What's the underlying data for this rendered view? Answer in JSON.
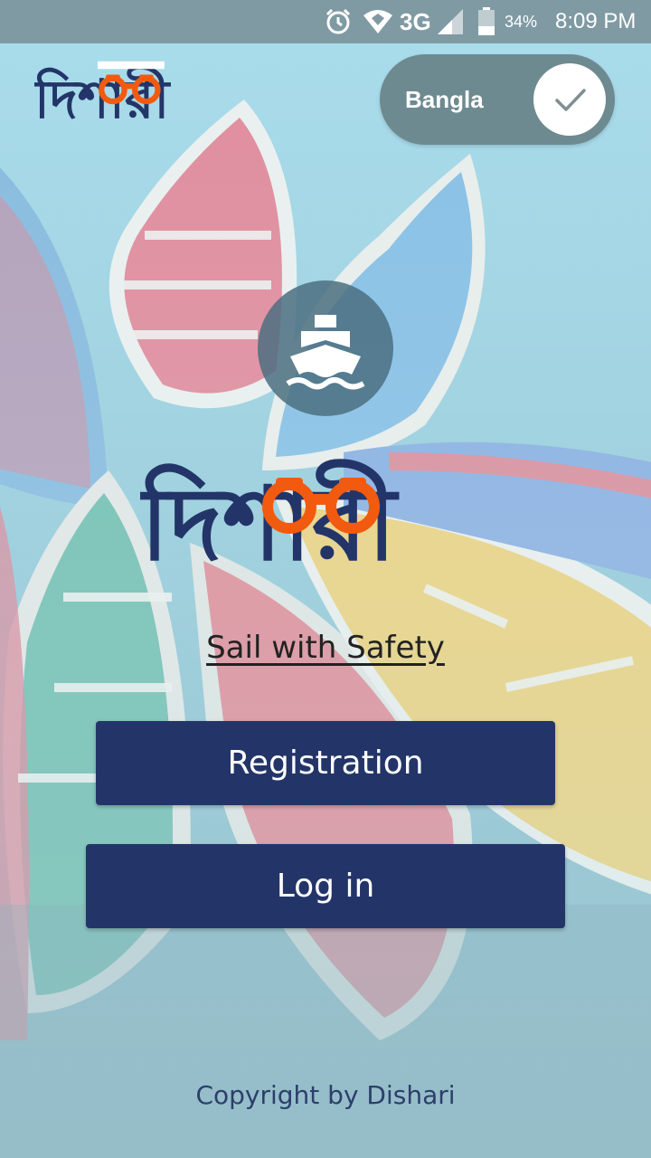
{
  "status_bar": {
    "network": "3G",
    "battery": "34%",
    "time": "8:09 PM",
    "icons": [
      "alarm-icon",
      "wifi-icon",
      "signal-icon",
      "battery-icon"
    ]
  },
  "header": {
    "logo_text": "দিশারী",
    "language_toggle": {
      "label": "Bangla",
      "checked": true,
      "icon": "check-icon"
    }
  },
  "main": {
    "hero_icon": "ship-icon",
    "logo_text": "দিশারী",
    "tagline": "Sail with Safety",
    "registration_label": "Registration",
    "login_label": "Log in"
  },
  "footer": {
    "copyright": "Copyright by Dishari"
  },
  "colors": {
    "brand_navy": "#233568",
    "brand_orange": "#f25a0f",
    "status_bar": "#7f9aa3",
    "toggle_track": "#6e8a91"
  }
}
